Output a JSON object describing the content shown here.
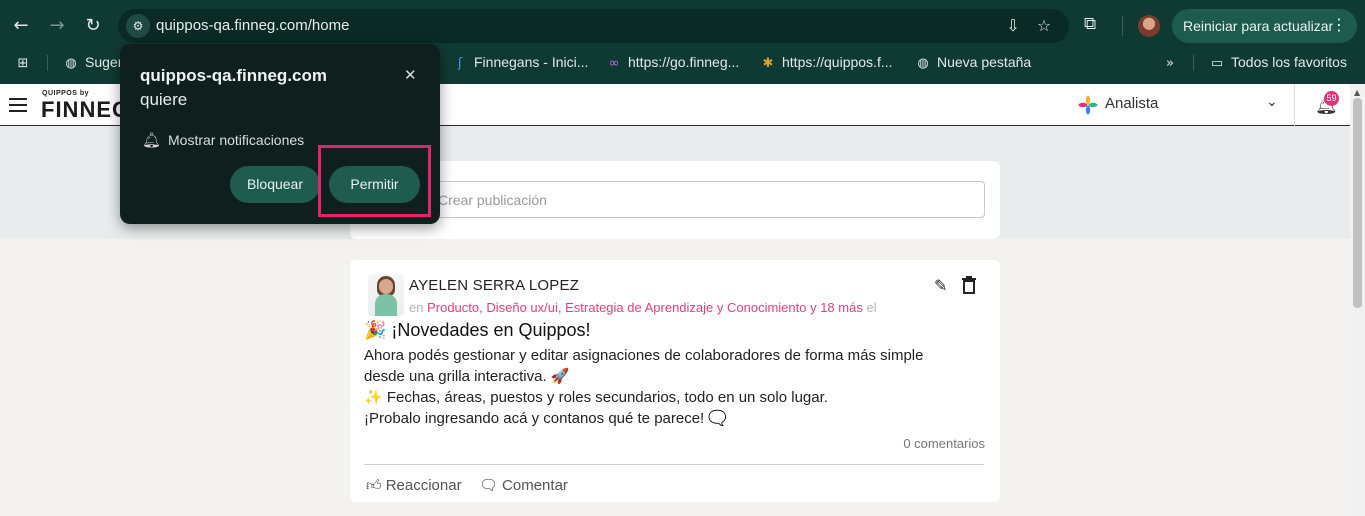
{
  "browser": {
    "url": "quippos-qa.finneg.com/home",
    "update_button": "Reiniciar para actualizar",
    "icons": {
      "back": "arrow-left-icon",
      "forward": "arrow-right-icon",
      "reload": "reload-icon",
      "site_info": "tune-icon",
      "install": "install-icon",
      "star": "star-icon",
      "extensions": "puzzle-icon",
      "menu": "more-vert-icon"
    },
    "bookmarks": [
      {
        "label": "Suger",
        "icon": "globe-icon"
      },
      {
        "label": "Finnegans - Inici...",
        "icon": "finnegans-icon"
      },
      {
        "label": "https://go.finneg...",
        "icon": "infinity-icon"
      },
      {
        "label": "https://quippos.f...",
        "icon": "quippos-icon"
      },
      {
        "label": "Nueva pestaña",
        "icon": "globe-icon"
      }
    ],
    "all_bookmarks": "Todos los favoritos",
    "accent": "#0f3a33"
  },
  "permission_popup": {
    "origin": "quippos-qa.finneg.com",
    "wants": "quiere",
    "permission": "Mostrar notificaciones",
    "block_label": "Bloquear",
    "allow_label": "Permitir",
    "highlight_color": "#e2246f"
  },
  "app": {
    "logo_small": "QUIPPOS by",
    "logo_big": "FINNEG",
    "role": "Analista",
    "notification_count": "59"
  },
  "composer": {
    "placeholder": "Crear publicación"
  },
  "post": {
    "author": "AYELEN SERRA LOPEZ",
    "in_prefix": "en",
    "tags": "Producto, Diseño ux/ui, Estrategia de Aprendizaje y Conocimiento y 18 más",
    "in_suffix": "el",
    "title": "🎉 ¡Novedades en Quippos!",
    "body_lines": [
      "Ahora podés gestionar y editar asignaciones de colaboradores de forma más simple",
      "desde una grilla interactiva. 🚀",
      "✨ Fechas, áreas, puestos y roles secundarios, todo en un solo lugar.",
      "¡Probalo ingresando acá y contanos qué te parece! 🗨️"
    ],
    "comments": "0 comentarios",
    "react_label": "Reaccionar",
    "comment_label": "Comentar",
    "tag_color": "#e0407f"
  }
}
